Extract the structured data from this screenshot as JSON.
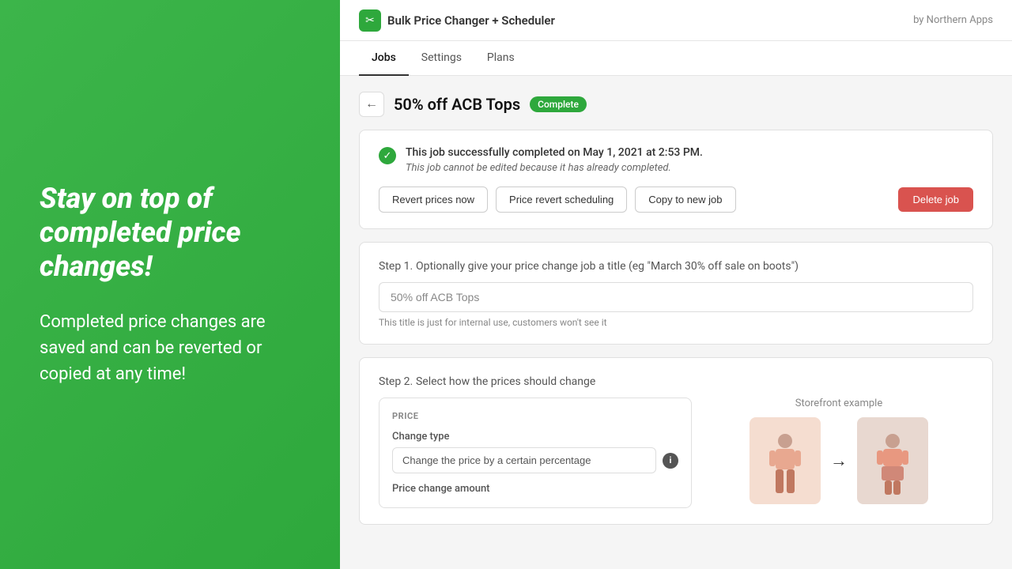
{
  "left": {
    "headline": "Stay on top of completed price changes!",
    "body": "Completed price changes are saved and can be reverted or copied at any time!"
  },
  "header": {
    "logo_icon": "✂",
    "app_title": "Bulk Price Changer + Scheduler",
    "by_label": "by Northern Apps"
  },
  "nav": {
    "tabs": [
      {
        "id": "jobs",
        "label": "Jobs",
        "active": true
      },
      {
        "id": "settings",
        "label": "Settings",
        "active": false
      },
      {
        "id": "plans",
        "label": "Plans",
        "active": false
      }
    ]
  },
  "page": {
    "back_label": "←",
    "title": "50% off ACB Tops",
    "status": "Complete",
    "success_message": "This job successfully completed on May 1, 2021 at 2:53 PM.",
    "edit_note": "This job cannot be edited because it has already completed.",
    "revert_now_label": "Revert prices now",
    "price_revert_scheduling_label": "Price revert scheduling",
    "copy_job_label": "Copy to new job",
    "delete_job_label": "Delete job"
  },
  "step1": {
    "label": "Step 1.",
    "description": "Optionally give your price change job a title (eg \"March 30% off sale on boots\")",
    "input_value": "50% off ACB Tops",
    "input_hint": "This title is just for internal use, customers won't see it"
  },
  "step2": {
    "label": "Step 2.",
    "description": "Select how the prices should change",
    "price_panel": {
      "section_label": "PRICE",
      "change_type_label": "Change type",
      "change_type_value": "Change the price by a certain percentage",
      "change_amount_label": "Price change amount"
    },
    "storefront": {
      "label": "Storefront example",
      "arrow": "→"
    }
  }
}
